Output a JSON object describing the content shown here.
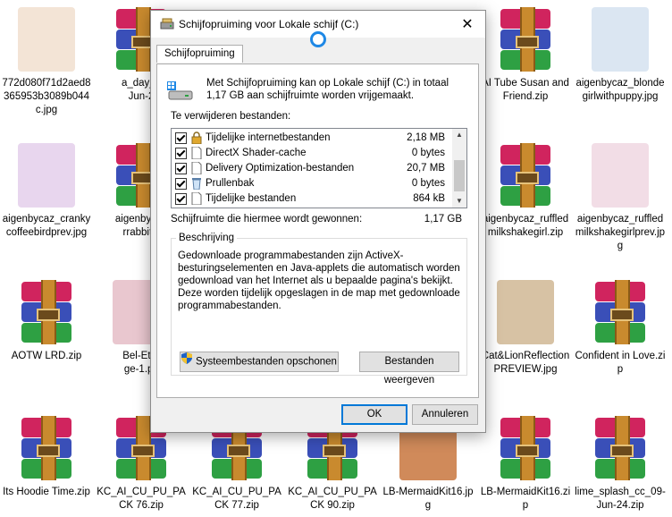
{
  "desktop": {
    "icons": [
      {
        "label": "772d080f71d2aed8365953b3089b044c.jpg",
        "kind": "image",
        "color": "#f3e4d6"
      },
      {
        "label": "a_day_o\nJun-2",
        "kind": "rar"
      },
      {
        "label": "AI Tube Susan and Friend.zip",
        "kind": "rar"
      },
      {
        "label": "aigenbycaz_blondegirlwithpuppy.jpg",
        "kind": "image",
        "color": "#dbe6f2"
      },
      {
        "label": "aigenbycaz_cranky coffeebirdprev.jpg",
        "kind": "image",
        "color": "#e8d6ee"
      },
      {
        "label": "aigenbycaz\nrrabbitw",
        "kind": "rar"
      },
      {
        "label": "aigenbycaz_ruffledmilkshakegirl.zip",
        "kind": "rar"
      },
      {
        "label": "aigenbycaz_ruffledmilkshakegirlprev.jpg",
        "kind": "image",
        "color": "#f2dde6"
      },
      {
        "label": "AOTW LRD.zip",
        "kind": "rar"
      },
      {
        "label": "Bel-Ete-\nge-1.ps",
        "kind": "image",
        "color": "#e9c7cf"
      },
      {
        "label": "Cat&LionReflectionPREVIEW.jpg",
        "kind": "image",
        "color": "#d7c2a4"
      },
      {
        "label": "Confident in Love.zip",
        "kind": "rar"
      },
      {
        "label": "Its Hoodie Time.zip",
        "kind": "rar"
      },
      {
        "label": "KC_AI_CU_PU_PACK 76.zip",
        "kind": "rar"
      },
      {
        "label": "KC_AI_CU_PU_PACK 77.zip",
        "kind": "rar"
      },
      {
        "label": "KC_AI_CU_PU_PACK 90.zip",
        "kind": "rar"
      },
      {
        "label": "LB-MermaidKit16.jpg",
        "kind": "image",
        "color": "#d08a5a"
      },
      {
        "label": "LB-MermaidKit16.zip",
        "kind": "rar"
      },
      {
        "label": "lime_splash_cc_09-Jun-24.zip",
        "kind": "rar"
      }
    ]
  },
  "dialog": {
    "title": "Schijfopruiming voor Lokale schijf (C:)",
    "close_glyph": "✕",
    "tab_label": "Schijfopruiming",
    "intro": "Met Schijfopruiming kan op Lokale schijf (C:) in totaal 1,17 GB aan schijfruimte worden vrijgemaakt.",
    "files_heading": "Te verwijderen bestanden:",
    "files": [
      {
        "name": "Tijdelijke internetbestanden",
        "size": "2,18 MB",
        "checked": true,
        "icon": "lock-icon"
      },
      {
        "name": "DirectX Shader-cache",
        "size": "0 bytes",
        "checked": true,
        "icon": "file-icon"
      },
      {
        "name": "Delivery Optimization-bestanden",
        "size": "20,7 MB",
        "checked": true,
        "icon": "file-icon"
      },
      {
        "name": "Prullenbak",
        "size": "0 bytes",
        "checked": true,
        "icon": "recycle-bin-icon"
      },
      {
        "name": "Tijdelijke bestanden",
        "size": "864 kB",
        "checked": true,
        "icon": "file-icon"
      }
    ],
    "gain_label": "Schijfruimte die hiermee wordt gewonnen:",
    "gain_value": "1,17 GB",
    "description_title": "Beschrijving",
    "description": "Gedownloade programmabestanden zijn ActiveX-besturingselementen en Java-applets die automatisch worden gedownload van het Internet als u bepaalde pagina's bekijkt. Deze worden tijdelijk opgeslagen in de map met gedownloade programmabestanden.",
    "cleanup_system_label": "Systeembestanden opschonen",
    "view_files_label": "Bestanden weergeven",
    "ok_label": "OK",
    "cancel_label": "Annuleren"
  }
}
